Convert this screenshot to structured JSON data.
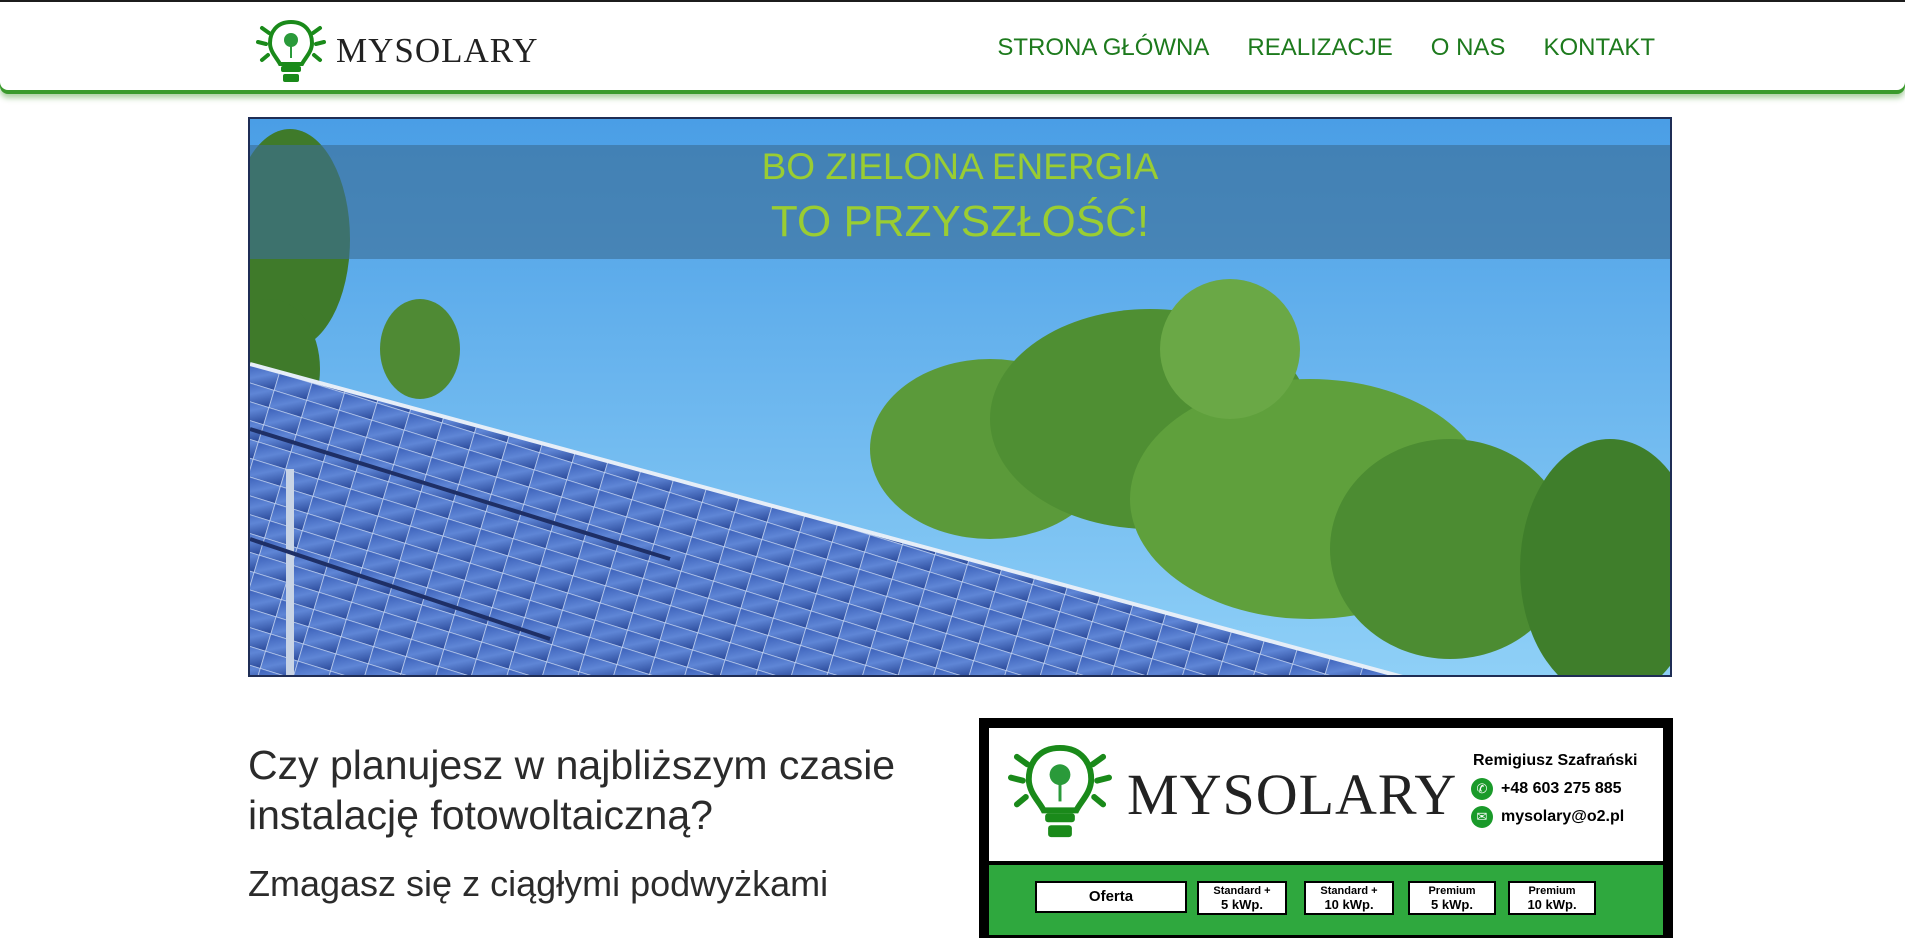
{
  "brand": {
    "name": "MYSOLARY"
  },
  "nav": {
    "items": [
      "STRONA GŁÓWNA",
      "REALIZACJE",
      "O NAS",
      "KONTAKT"
    ]
  },
  "hero": {
    "line1": "BO ZIELONA ENERGIA",
    "line2": "TO PRZYSZŁOŚĆ!"
  },
  "intro": {
    "heading": "Czy planujesz w najbliższym czasie instalację fotowoltaiczną?",
    "subheading": "Zmagasz się z ciągłymi podwyżkami"
  },
  "card": {
    "brand": "MYSOLARY",
    "contact_name": "Remigiusz Szafrański",
    "phone": "+48 603 275 885",
    "email": "mysolary@o2.pl",
    "offer_label": "Oferta",
    "plans": [
      {
        "name": "Standard +",
        "power": "5 kWp."
      },
      {
        "name": "Standard +",
        "power": "10 kWp."
      },
      {
        "name": "Premium",
        "power": "5 kWp."
      },
      {
        "name": "Premium",
        "power": "10 kWp."
      }
    ]
  },
  "colors": {
    "accent": "#1d7a1d",
    "hero_text": "#9acd32",
    "card_green": "#2fa83e"
  }
}
